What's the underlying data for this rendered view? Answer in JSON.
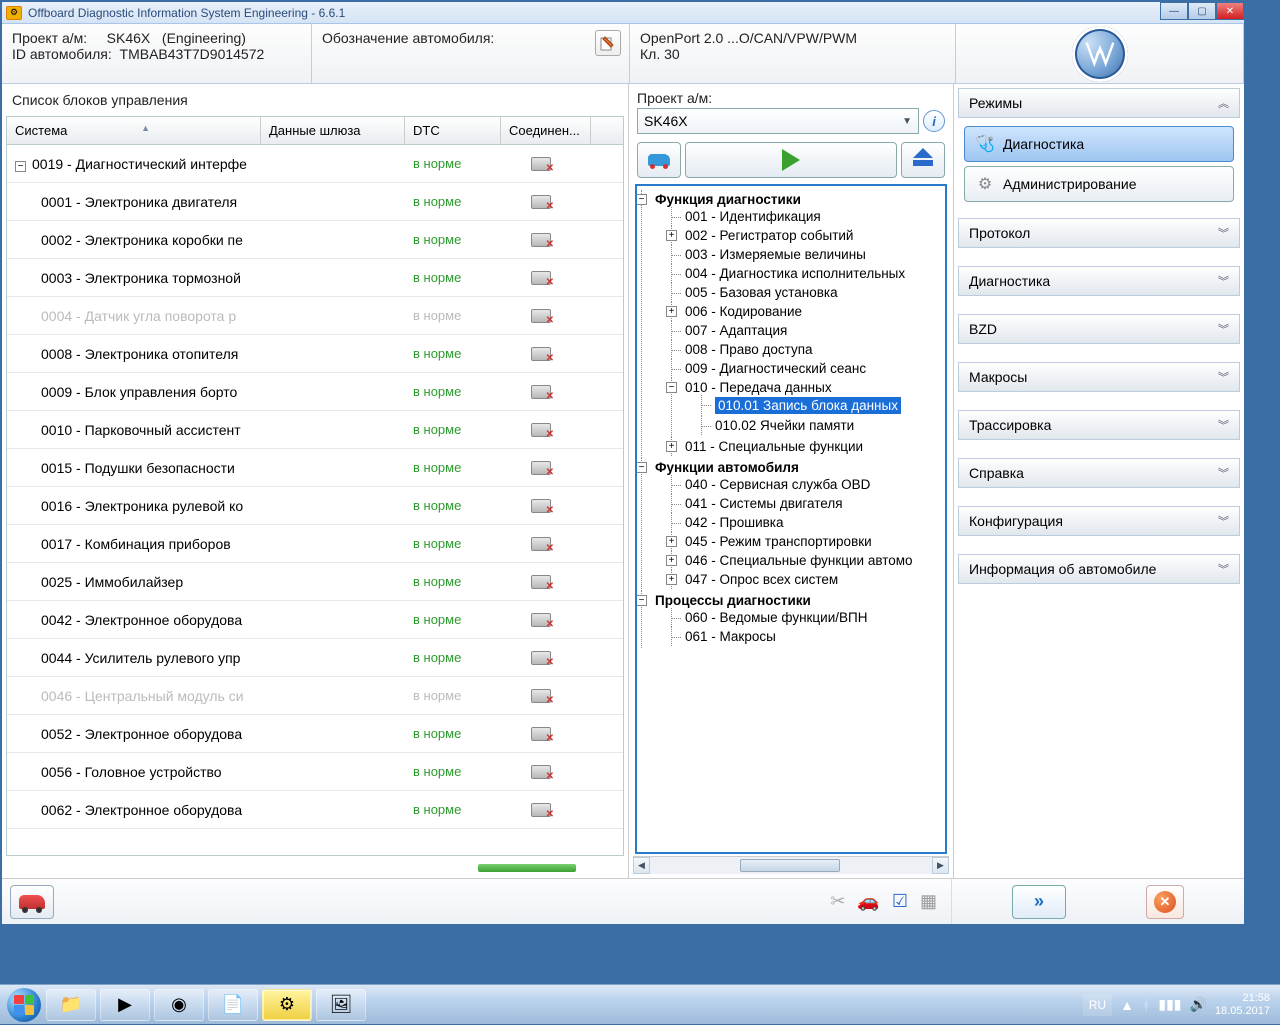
{
  "window": {
    "title": "Offboard Diagnostic Information System Engineering - 6.6.1"
  },
  "header": {
    "project_label": "Проект а/м:",
    "project_value": "SK46X",
    "project_env": "(Engineering)",
    "vehid_label": "ID автомобиля:",
    "vehid_value": "TMBAB43T7D9014572",
    "designation_label": "Обозначение автомобиля:",
    "connection_line": "OpenPort 2.0 ...O/CAN/VPW/PWM",
    "kl_line": "Кл. 30"
  },
  "left": {
    "title": "Список блоков управления",
    "columns": {
      "system": "Система",
      "gateway": "Данные шлюза",
      "dtc": "DTC",
      "connection": "Соединен..."
    },
    "rows": [
      {
        "sys": "0019 - Диагностический интерфе",
        "dtc": "в норме",
        "type": "parent"
      },
      {
        "sys": "0001 - Электроника двигателя",
        "dtc": "в норме",
        "type": "child"
      },
      {
        "sys": "0002 - Электроника коробки пе",
        "dtc": "в норме",
        "type": "child"
      },
      {
        "sys": "0003 - Электроника тормозной",
        "dtc": "в норме",
        "type": "child"
      },
      {
        "sys": "0004 - Датчик угла поворота р",
        "dtc": "в норме",
        "type": "child",
        "disabled": true
      },
      {
        "sys": "0008 - Электроника отопителя",
        "dtc": "в норме",
        "type": "child"
      },
      {
        "sys": "0009 - Блок управления борто",
        "dtc": "в норме",
        "type": "child"
      },
      {
        "sys": "0010 - Парковочный ассистент",
        "dtc": "в норме",
        "type": "child"
      },
      {
        "sys": "0015 - Подушки безопасности",
        "dtc": "в норме",
        "type": "child"
      },
      {
        "sys": "0016 - Электроника рулевой ко",
        "dtc": "в норме",
        "type": "child"
      },
      {
        "sys": "0017 - Комбинация приборов",
        "dtc": "в норме",
        "type": "child"
      },
      {
        "sys": "0025 - Иммобилайзер",
        "dtc": "в норме",
        "type": "child"
      },
      {
        "sys": "0042 - Электронное оборудова",
        "dtc": "в норме",
        "type": "child"
      },
      {
        "sys": "0044 - Усилитель рулевого упр",
        "dtc": "в норме",
        "type": "child"
      },
      {
        "sys": "0046 - Центральный модуль си",
        "dtc": "в норме",
        "type": "child",
        "disabled": true
      },
      {
        "sys": "0052 - Электронное оборудова",
        "dtc": "в норме",
        "type": "child"
      },
      {
        "sys": "0056 - Головное устройство",
        "dtc": "в норме",
        "type": "child"
      },
      {
        "sys": "0062 - Электронное оборудова",
        "dtc": "в норме",
        "type": "child"
      }
    ]
  },
  "mid": {
    "project_label": "Проект а/м:",
    "project_selected": "SK46X",
    "tree": {
      "g1": "Функция диагностики",
      "n001": "001 - Идентификация",
      "n002": "002 - Регистратор событий",
      "n003": "003 - Измеряемые величины",
      "n004": "004 - Диагностика исполнительных",
      "n005": "005 - Базовая установка",
      "n006": "006 - Кодирование",
      "n007": "007 - Адаптация",
      "n008": "008 - Право доступа",
      "n009": "009 - Диагностический сеанс",
      "n010": "010 - Передача данных",
      "n010_01": "010.01 Запись блока данных",
      "n010_02": "010.02 Ячейки памяти",
      "n011": "011 - Специальные функции",
      "g2": "Функции автомобиля",
      "n040": "040 - Сервисная служба OBD",
      "n041": "041 - Системы двигателя",
      "n042": "042 - Прошивка",
      "n045": "045 - Режим транспортировки",
      "n046": "046 - Специальные функции автомо",
      "n047": "047 - Опрос всех систем",
      "g3": "Процессы диагностики",
      "n060": "060 - Ведомые функции/ВПН",
      "n061": "061 - Макросы"
    }
  },
  "right": {
    "modes_title": "Режимы",
    "diag": "Диагностика",
    "admin": "Администрирование",
    "sections": [
      "Протокол",
      "Диагностика",
      "BZD",
      "Макросы",
      "Трассировка",
      "Справка",
      "Конфигурация",
      "Информация об автомобиле"
    ]
  },
  "taskbar": {
    "lang": "RU",
    "time": "21:58",
    "date": "18.05.2017"
  }
}
